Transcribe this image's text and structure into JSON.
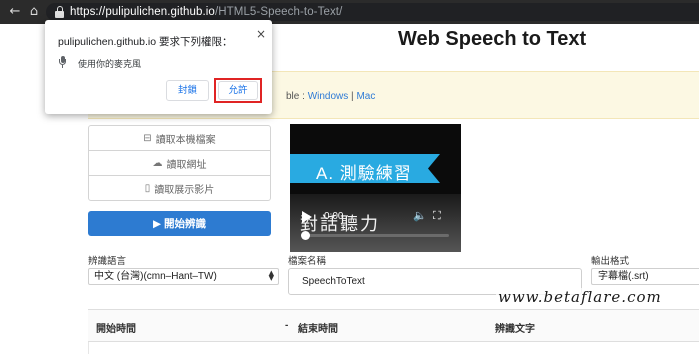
{
  "browser": {
    "url_host": "https://pulipulichen.github.io",
    "url_path": "/HTML5-Speech-to-Text/",
    "back_icon": "back-arrow-icon",
    "home_icon": "home-icon",
    "lock_icon": "lock-icon"
  },
  "page": {
    "title": "Web Speech to Text",
    "notice": {
      "prefix": "ble :",
      "windows_link": "Windows",
      "separator": "|",
      "mac_link": "Mac"
    },
    "sources": [
      {
        "label": "讀取本機檔案",
        "icon": "hard-drive-icon"
      },
      {
        "label": "讀取網址",
        "icon": "cloud-icon"
      },
      {
        "label": "讀取展示影片",
        "icon": "bookmark-icon"
      }
    ],
    "start_button": "▶ 開始辨識",
    "video": {
      "banner": "A. 測驗練習",
      "subtitle": "對話聽力",
      "time": "0:00",
      "progress": 0
    },
    "fields": {
      "language_label": "辨識語言",
      "language_value": "中文 (台灣)(cmn–Hant–TW)",
      "filename_label": "檔案名稱",
      "filename_value": "SpeechToText",
      "output_label": "輸出格式",
      "output_value": "字幕檔(.srt)"
    },
    "table": {
      "col_start": "開始時間",
      "col_dash": "-",
      "col_end": "結束時間",
      "col_text": "辨識文字"
    }
  },
  "popup": {
    "title": "pulipulichen.github.io 要求下列權限：",
    "close": "×",
    "permission": "使用你的麥克風",
    "block_label": "封鎖",
    "allow_label": "允許",
    "highlight_color": "#e02424"
  },
  "watermark": "www.betaflare.com",
  "colors": {
    "primary": "#2d7bd1",
    "notice_bg": "#fcf8e3",
    "link": "#2f7bd6",
    "video_banner": "#29aae1"
  }
}
